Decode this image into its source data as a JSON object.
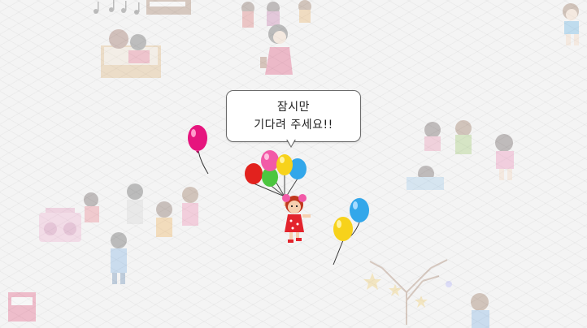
{
  "loading": {
    "message_line1": "잠시만",
    "message_line2": "기다려 주세요!!"
  },
  "icons": [
    "music-notes-icon",
    "balloon-icon",
    "girl-with-balloons-icon",
    "boombox-icon",
    "tree-icon",
    "star-icon"
  ],
  "colors": {
    "background": "#f4f4f4",
    "balloon_magenta": "#e6157e",
    "balloon_pink": "#f25aa8",
    "balloon_yellow": "#f7d21b",
    "balloon_blue": "#33a7ea",
    "balloon_red": "#e2221e",
    "balloon_green": "#4cc63f",
    "dress_red": "#e3232c"
  }
}
